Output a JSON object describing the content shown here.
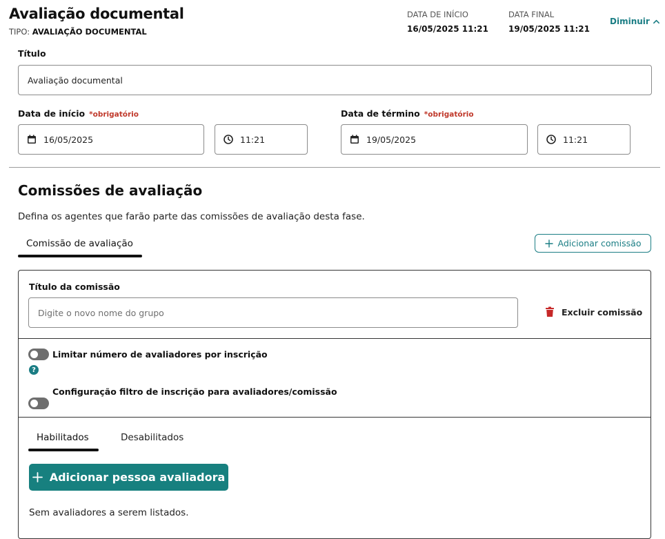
{
  "header": {
    "title": "Avaliação documental",
    "type_prefix": "TIPO:",
    "type_value": "AVALIAÇÃO DOCUMENTAL",
    "start_label": "DATA DE INÍCIO",
    "start_value": "16/05/2025 11:21",
    "end_label": "DATA FINAL",
    "end_value": "19/05/2025 11:21",
    "collapse_label": "Diminuir",
    "collapse_icon": "chevron-up-icon"
  },
  "form": {
    "title_label": "Título",
    "title_value": "Avaliação documental",
    "start_date_label": "Data de início",
    "end_date_label": "Data de término",
    "required_text": "*obrigatório",
    "start_date_value": "16/05/2025",
    "start_time_value": "11:21",
    "end_date_value": "19/05/2025",
    "end_time_value": "11:21"
  },
  "commissions": {
    "section_title": "Comissões de avaliação",
    "description": "Defina os agentes que farão parte das comissões de avaliação desta fase.",
    "tab_label": "Comissão de avaliação",
    "add_commission_label": "Adicionar comissão",
    "commission_title_label": "Título da comissão",
    "commission_title_placeholder": "Digite o novo nome do grupo",
    "commission_title_value": "",
    "delete_label": "Excluir comissão",
    "toggle_limit_label": "Limitar número de avaliadores por inscrição",
    "toggle_filter_label": "Configuração filtro de inscrição para avaliadores/comissão",
    "help_glyph": "?",
    "tabs": [
      "Habilitados",
      "Desabilitados"
    ],
    "add_evaluator_label": "Adicionar pessoa avaliadora",
    "empty_message": "Sem avaliadores a serem listados."
  },
  "colors": {
    "accent": "#1a7d84",
    "primary_button": "#17807f",
    "required": "#c0392b",
    "delete_icon": "#c62828",
    "toggle_off": "#6e6e6e"
  }
}
